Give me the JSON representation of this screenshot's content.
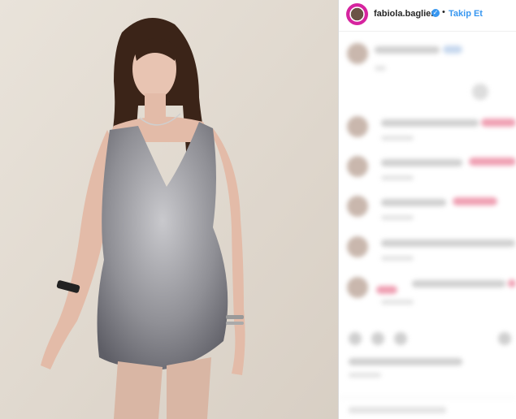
{
  "post": {
    "username": "fabiola.baglieri",
    "follow_label": "Takip Et",
    "separator": "•",
    "verified_glyph": "✓"
  },
  "icons": {
    "avatar": "profile-avatar",
    "verified": "verified-badge-icon"
  },
  "colors": {
    "link": "#3897f0",
    "text": "#262626",
    "wall": "#e6dfd5",
    "dress": "#a9a9ad"
  }
}
